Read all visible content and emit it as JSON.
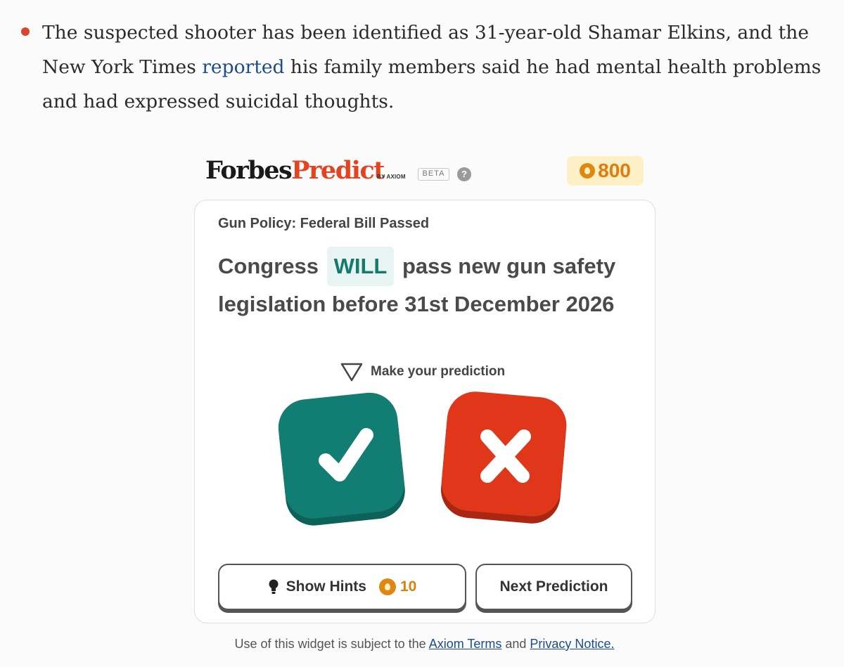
{
  "article": {
    "text_before_link": "The suspected shooter has been identified as 31-year-old Shamar Elkins, and the New York Times ",
    "link_text": "reported",
    "text_after_link": " his family members said he had mental health problems and had expressed suicidal thoughts."
  },
  "widget": {
    "logo_forbes": "Forbes",
    "logo_predict": "Predict",
    "by_axiom": "BY AXIOM",
    "beta": "BETA",
    "help": "?",
    "coins": "800",
    "category": "Gun Policy: Federal Bill Passed",
    "question_before": "Congress",
    "question_highlight": "WILL",
    "question_after": "pass new gun safety legislation before 31st December 2026",
    "make_prediction": "Make your prediction",
    "show_hints": "Show Hints",
    "hint_cost": "10",
    "next_prediction": "Next Prediction"
  },
  "footer": {
    "text_before": "Use of this widget is subject to the ",
    "terms_link": "Axiom Terms",
    "text_middle": " and ",
    "privacy_link": "Privacy Notice."
  },
  "colors": {
    "yes": "#127d72",
    "no": "#e0361a",
    "accent_orange": "#e07d0a",
    "link": "#1d4b8f"
  },
  "icons": [
    "bullet-icon",
    "help-icon",
    "coin-icon",
    "triangle-icon",
    "check-icon",
    "cross-icon",
    "lightbulb-icon"
  ]
}
